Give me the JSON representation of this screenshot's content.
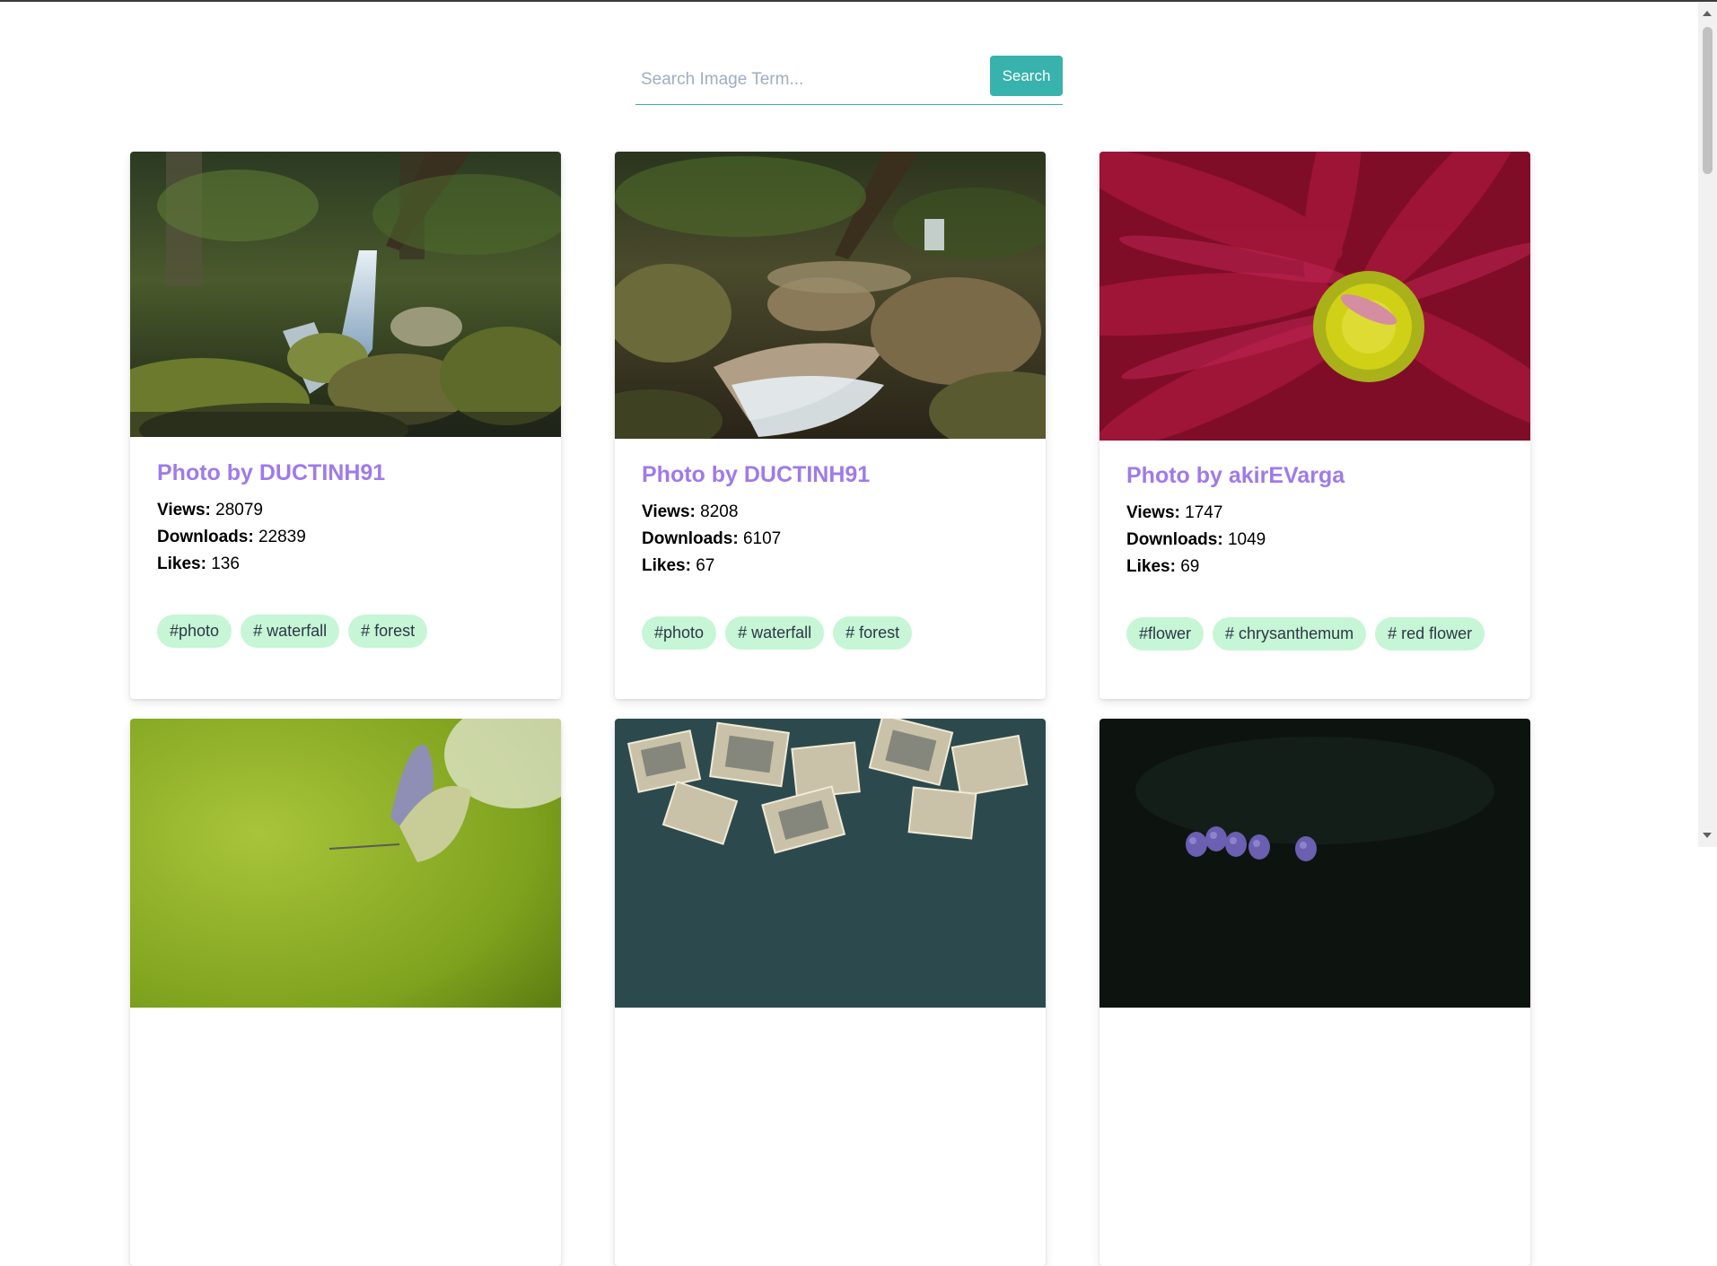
{
  "search": {
    "placeholder": "Search Image Term...",
    "button_label": "Search"
  },
  "cards": [
    {
      "title": "Photo by DUCTINH91",
      "image": "waterfall-forest-photo",
      "views_label": "Views:",
      "views": "28079",
      "downloads_label": "Downloads:",
      "downloads": "22839",
      "likes_label": "Likes:",
      "likes": "136",
      "tags": [
        "#photo",
        "# waterfall",
        "# forest"
      ]
    },
    {
      "title": "Photo by DUCTINH91",
      "image": "forest-stream-photo",
      "views_label": "Views:",
      "views": "8208",
      "downloads_label": "Downloads:",
      "downloads": "6107",
      "likes_label": "Likes:",
      "likes": "67",
      "tags": [
        "#photo",
        "# waterfall",
        "# forest"
      ]
    },
    {
      "title": "Photo by akirEVarga",
      "image": "red-chrysanthemum-photo",
      "views_label": "Views:",
      "views": "1747",
      "downloads_label": "Downloads:",
      "downloads": "1049",
      "likes_label": "Likes:",
      "likes": "69",
      "tags": [
        "#flower",
        "# chrysanthemum",
        "# red flower"
      ]
    },
    {
      "image": "butterfly-photo"
    },
    {
      "image": "old-photographs-photo"
    },
    {
      "image": "purple-flower-dark-photo"
    }
  ],
  "colors": {
    "accent": "#38b2ac",
    "title": "#9f7aea",
    "tag_bg": "#c6f6d5"
  }
}
